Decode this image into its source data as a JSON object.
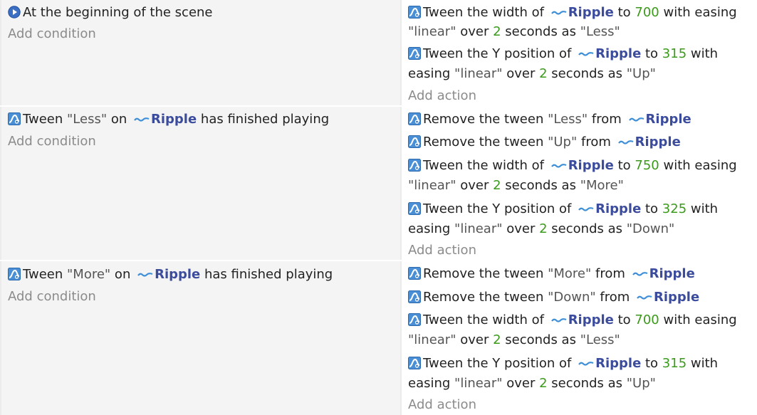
{
  "add_condition": "Add condition",
  "add_action": "Add action",
  "events": [
    {
      "condition": {
        "text": "At the beginning of the scene",
        "icon": "scene-start-icon"
      },
      "actions": [
        {
          "pre": "Tween the width of ",
          "obj": "Ripple",
          "mid": " to ",
          "num": "700",
          "post": " with easing",
          "l2a": "\"linear\"",
          "l2b": " over ",
          "l2num": "2",
          "l2c": " seconds as ",
          "l2str": "\"Less\""
        },
        {
          "pre": "Tween the Y position of ",
          "obj": "Ripple",
          "mid": " to ",
          "num": "315",
          "post": " with",
          "l2a": "easing ",
          "l2q": "\"linear\"",
          "l2b": " over ",
          "l2num": "2",
          "l2c": " seconds as ",
          "l2str": "\"Up\""
        }
      ]
    },
    {
      "condition": {
        "pre": "Tween ",
        "str": "\"Less\"",
        "mid": " on ",
        "obj": "Ripple",
        "post": " has finished playing",
        "icon": "tween-icon"
      },
      "actions": [
        {
          "pre": "Remove the tween ",
          "str": "\"Less\"",
          "mid": " from ",
          "obj": "Ripple"
        },
        {
          "pre": "Remove the tween ",
          "str": "\"Up\"",
          "mid": " from ",
          "obj": "Ripple"
        },
        {
          "pre": "Tween the width of ",
          "obj": "Ripple",
          "mid": " to ",
          "num": "750",
          "post": " with easing",
          "l2a": "\"linear\"",
          "l2b": " over ",
          "l2num": "2",
          "l2c": " seconds as ",
          "l2str": "\"More\""
        },
        {
          "pre": "Tween the Y position of ",
          "obj": "Ripple",
          "mid": " to ",
          "num": "325",
          "post": " with",
          "l2a": "easing ",
          "l2q": "\"linear\"",
          "l2b": " over ",
          "l2num": "2",
          "l2c": " seconds as ",
          "l2str": "\"Down\""
        }
      ]
    },
    {
      "condition": {
        "pre": "Tween ",
        "str": "\"More\"",
        "mid": " on ",
        "obj": "Ripple",
        "post": " has finished playing",
        "icon": "tween-icon"
      },
      "actions": [
        {
          "pre": "Remove the tween ",
          "str": "\"More\"",
          "mid": " from ",
          "obj": "Ripple"
        },
        {
          "pre": "Remove the tween ",
          "str": "\"Down\"",
          "mid": " from ",
          "obj": "Ripple"
        },
        {
          "pre": "Tween the width of ",
          "obj": "Ripple",
          "mid": " to ",
          "num": "700",
          "post": " with easing",
          "l2a": "\"linear\"",
          "l2b": " over ",
          "l2num": "2",
          "l2c": " seconds as ",
          "l2str": "\"Less\""
        },
        {
          "pre": "Tween the Y position of ",
          "obj": "Ripple",
          "mid": " to ",
          "num": "315",
          "post": " with",
          "l2a": "easing ",
          "l2q": "\"linear\"",
          "l2b": " over ",
          "l2num": "2",
          "l2c": " seconds as ",
          "l2str": "\"Up\""
        }
      ]
    }
  ]
}
